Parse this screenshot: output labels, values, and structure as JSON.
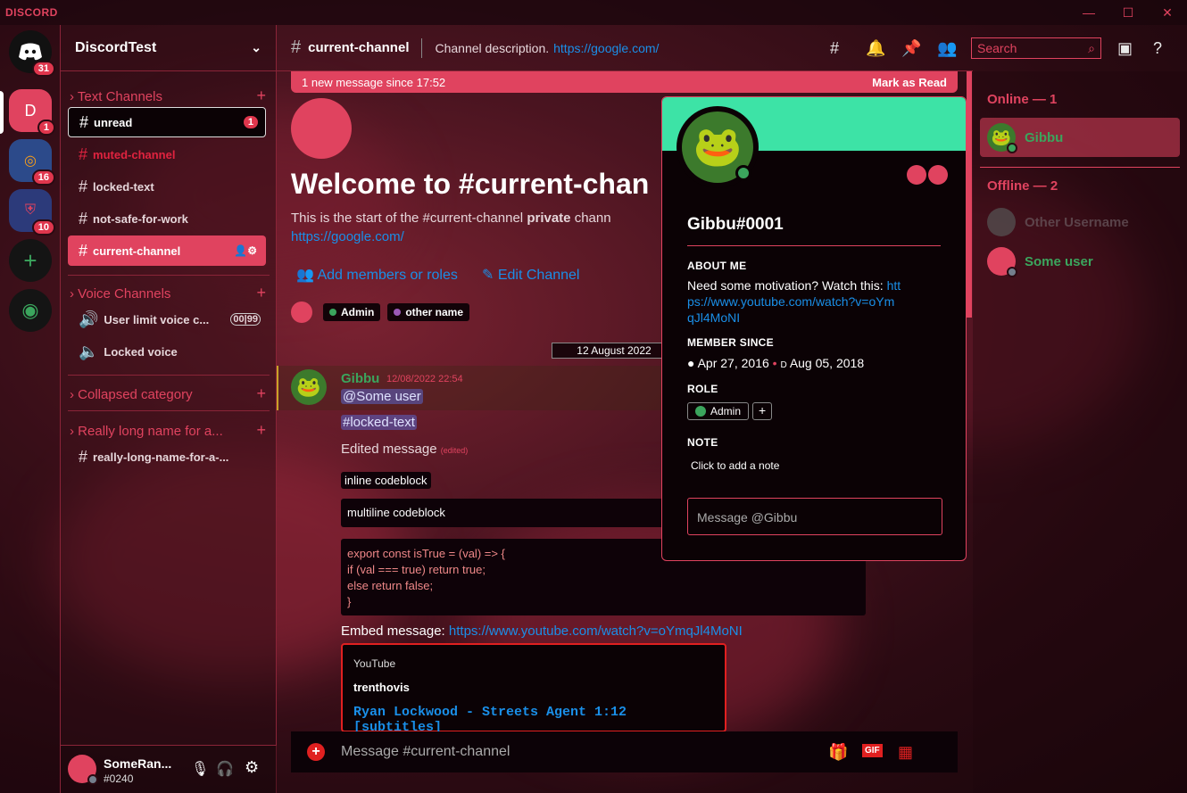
{
  "titlebar": {
    "logo": "DISCORD"
  },
  "servers": {
    "home_badge": "31",
    "items": [
      {
        "label": "D",
        "badge": "1"
      },
      {
        "badge": "16"
      },
      {
        "badge": "10"
      }
    ]
  },
  "guild": {
    "name": "DiscordTest"
  },
  "categories": {
    "text": "Text Channels",
    "voice": "Voice Channels",
    "collapsed": "Collapsed category",
    "long": "Really long name for a..."
  },
  "channels": [
    "unread",
    "muted-channel",
    "locked-text",
    "not-safe-for-work",
    "current-channel"
  ],
  "unread_badge": "1",
  "voice": [
    {
      "name": "User limit voice c...",
      "count": "00",
      "limit": "99"
    },
    {
      "name": "Locked voice"
    }
  ],
  "long_channel": "really-long-name-for-a-...",
  "user": {
    "name": "SomeRan...",
    "tag": "#0240"
  },
  "header": {
    "channel": "current-channel",
    "description": "Channel description.",
    "link": "https://google.com/",
    "search": "Search"
  },
  "newbar": {
    "text": "1 new message since 17:52",
    "action": "Mark as Read"
  },
  "welcome": {
    "title": "Welcome to #current-chan",
    "desc_start": "This is the start of the #current-channel",
    "desc_bold": "private",
    "desc_end": "chann",
    "link": "https://google.com/",
    "add": "Add members or roles",
    "edit": "Edit Channel"
  },
  "roles": [
    {
      "name": "Admin",
      "color": "#3ba55d"
    },
    {
      "name": "other name",
      "color": "#9b59b6"
    }
  ],
  "divider": "12 August 2022",
  "message": {
    "author": "Gibbu",
    "time": "12/08/2022 22:54",
    "mention": "@Some user",
    "channel_mention": "#locked-text",
    "edited_text": "Edited message",
    "edited_tag": "(edited)",
    "inline_code": "inline codeblock",
    "multiline": "multiline codeblock",
    "code": [
      "export const isTrue = (val) => {",
      "  if (val === true) return true;",
      "  else return false;",
      "}"
    ],
    "embed_label": "Embed message:",
    "embed_link": "https://www.youtube.com/watch?v=oYmqJl4MoNI",
    "embed": {
      "provider": "YouTube",
      "author": "trenthovis",
      "title": "Ryan Lockwood - Streets Agent 1:12 [subtitles]"
    }
  },
  "composer": {
    "placeholder": "Message #current-channel"
  },
  "members": {
    "online": "Online — 1",
    "offline": "Offline — 2",
    "list": [
      {
        "name": "Gibbu",
        "color": "#3ba55d"
      },
      {
        "name": "Other Username",
        "color": "#6b5a60"
      },
      {
        "name": "Some user",
        "color": "#3ba55d"
      }
    ]
  },
  "popout": {
    "banner": "#3de3a6",
    "name": "Gibbu#0001",
    "about_title": "ABOUT ME",
    "about": "Need some motivation? Watch this:",
    "about_link": "https://www.youtube.com/watch?v=oYmqJl4MoNI",
    "since_title": "MEMBER SINCE",
    "since_discord": "Apr 27, 2016",
    "since_server": "Aug 05, 2018",
    "role_title": "ROLE",
    "role": "Admin",
    "note_title": "NOTE",
    "note": "Click to add a note",
    "message_placeholder": "Message @Gibbu"
  },
  "colors": {
    "accent": "#e0435f",
    "link": "#1a8fe8",
    "online": "#3ba55d"
  }
}
